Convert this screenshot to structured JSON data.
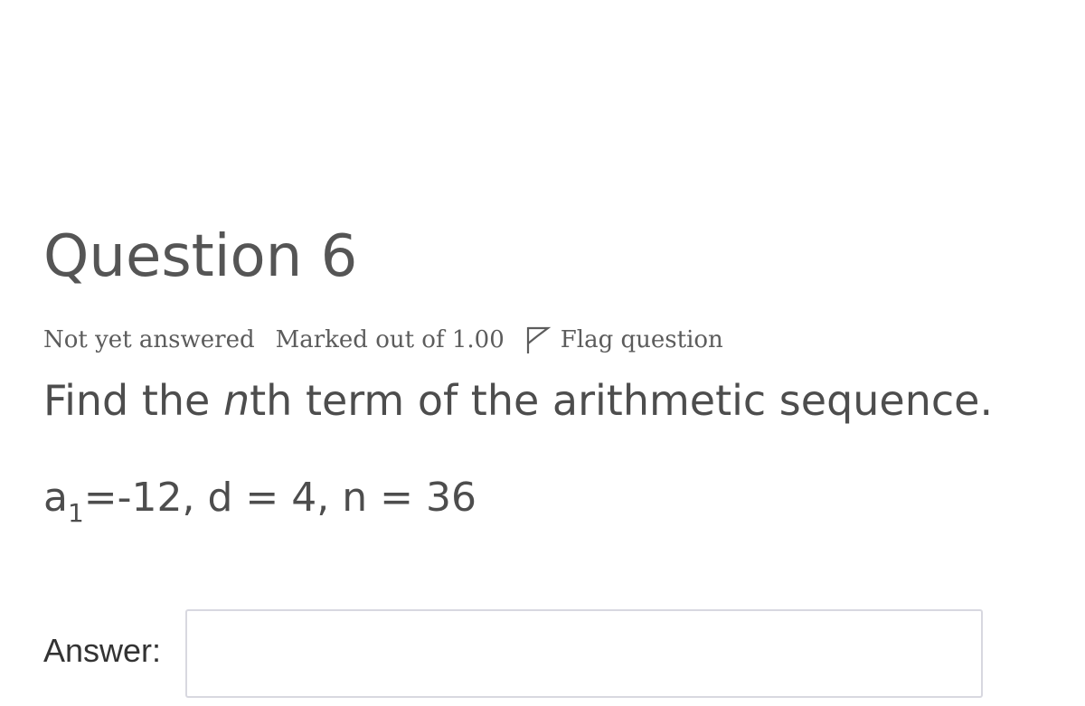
{
  "question": {
    "title": "Question 6",
    "status": "Not yet answered",
    "grade": "Marked out of 1.00",
    "flag_label": "Flag question",
    "flag_icon": "flag-outline-icon",
    "text_before_var": "Find the ",
    "text_var": "n",
    "text_after_var": "th term of the arithmetic sequence.",
    "given_a": "a",
    "given_sub": "1",
    "given_rest": "=-12, d = 4, n = 36"
  },
  "answer": {
    "label": "Answer:",
    "value": "",
    "placeholder": ""
  },
  "colors": {
    "text": "#4f4f4f",
    "input_border": "#d8d8e0",
    "background": "#ffffff"
  }
}
